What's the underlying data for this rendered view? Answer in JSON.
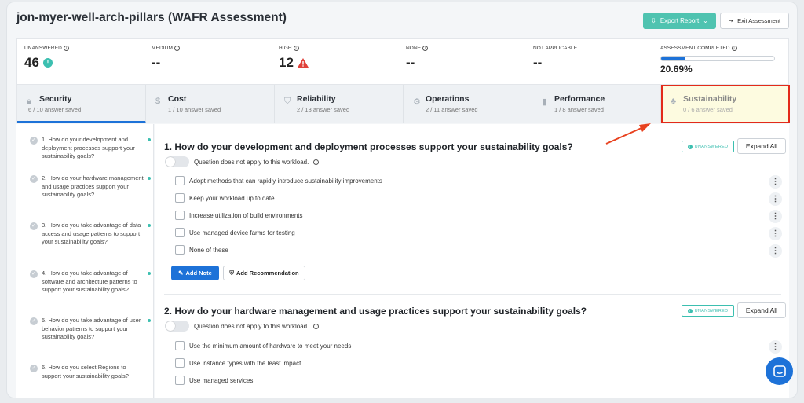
{
  "header": {
    "title": "jon-myer-well-arch-pillars (WAFR Assessment)",
    "export_label": "Export Report",
    "exit_label": "Exit Assessment"
  },
  "stats": {
    "unanswered": {
      "label": "UNANSWERED",
      "value": "46"
    },
    "medium": {
      "label": "MEDIUM",
      "value": "--"
    },
    "high": {
      "label": "HIGH",
      "value": "12"
    },
    "none": {
      "label": "NONE",
      "value": "--"
    },
    "not_applicable": {
      "label": "NOT APPLICABLE",
      "value": "--"
    },
    "completed": {
      "label": "ASSESSMENT COMPLETED",
      "value": "20.69%",
      "fraction": 0.2069
    }
  },
  "tabs": [
    {
      "name": "Security",
      "sub": "6 / 10 answer saved",
      "icon": "lock-icon"
    },
    {
      "name": "Cost",
      "sub": "1 / 10 answer saved",
      "icon": "dollar-icon"
    },
    {
      "name": "Reliability",
      "sub": "2 / 13 answer saved",
      "icon": "shield-icon"
    },
    {
      "name": "Operations",
      "sub": "2 / 11 answer saved",
      "icon": "gear-icon"
    },
    {
      "name": "Performance",
      "sub": "1 / 8 answer saved",
      "icon": "bar-chart-icon"
    },
    {
      "name": "Sustainability",
      "sub": "0 / 6 answer saved",
      "icon": "leaf-icon"
    }
  ],
  "sidebar": {
    "items": [
      "1. How do your development and deployment processes support your sustainability goals?",
      "2. How do your hardware management and usage practices support your sustainability goals?",
      "3. How do you take advantage of data access and usage patterns to support your sustainability goals?",
      "4. How do you take advantage of software and architecture patterns to support your sustainability goals?",
      "5. How do you take advantage of user behavior patterns to support your sustainability goals?",
      "6. How do you select Regions to support your sustainability goals?"
    ]
  },
  "questions": [
    {
      "title": "1. How do your development and deployment processes support your sustainability goals?",
      "status": "UNANSWERED",
      "expand": "Expand All",
      "toggle_label": "Question does not apply to this workload.",
      "options": [
        "Adopt methods that can rapidly introduce sustainability improvements",
        "Keep your workload up to date",
        "Increase utilization of build environments",
        "Use managed device farms for testing",
        "None of these"
      ],
      "add_note": "Add Note",
      "add_recommendation": "Add Recommendation"
    },
    {
      "title": "2. How do your hardware management and usage practices support your sustainability goals?",
      "status": "UNANSWERED",
      "expand": "Expand All",
      "toggle_label": "Question does not apply to this workload.",
      "options": [
        "Use the minimum amount of hardware to meet your needs",
        "Use instance types with the least impact",
        "Use managed services"
      ]
    }
  ],
  "colors": {
    "accent": "#1d72d8",
    "teal": "#3cbfb0",
    "highlight_border": "#e32a1a",
    "highlight_bg": "#fdfbe0"
  }
}
